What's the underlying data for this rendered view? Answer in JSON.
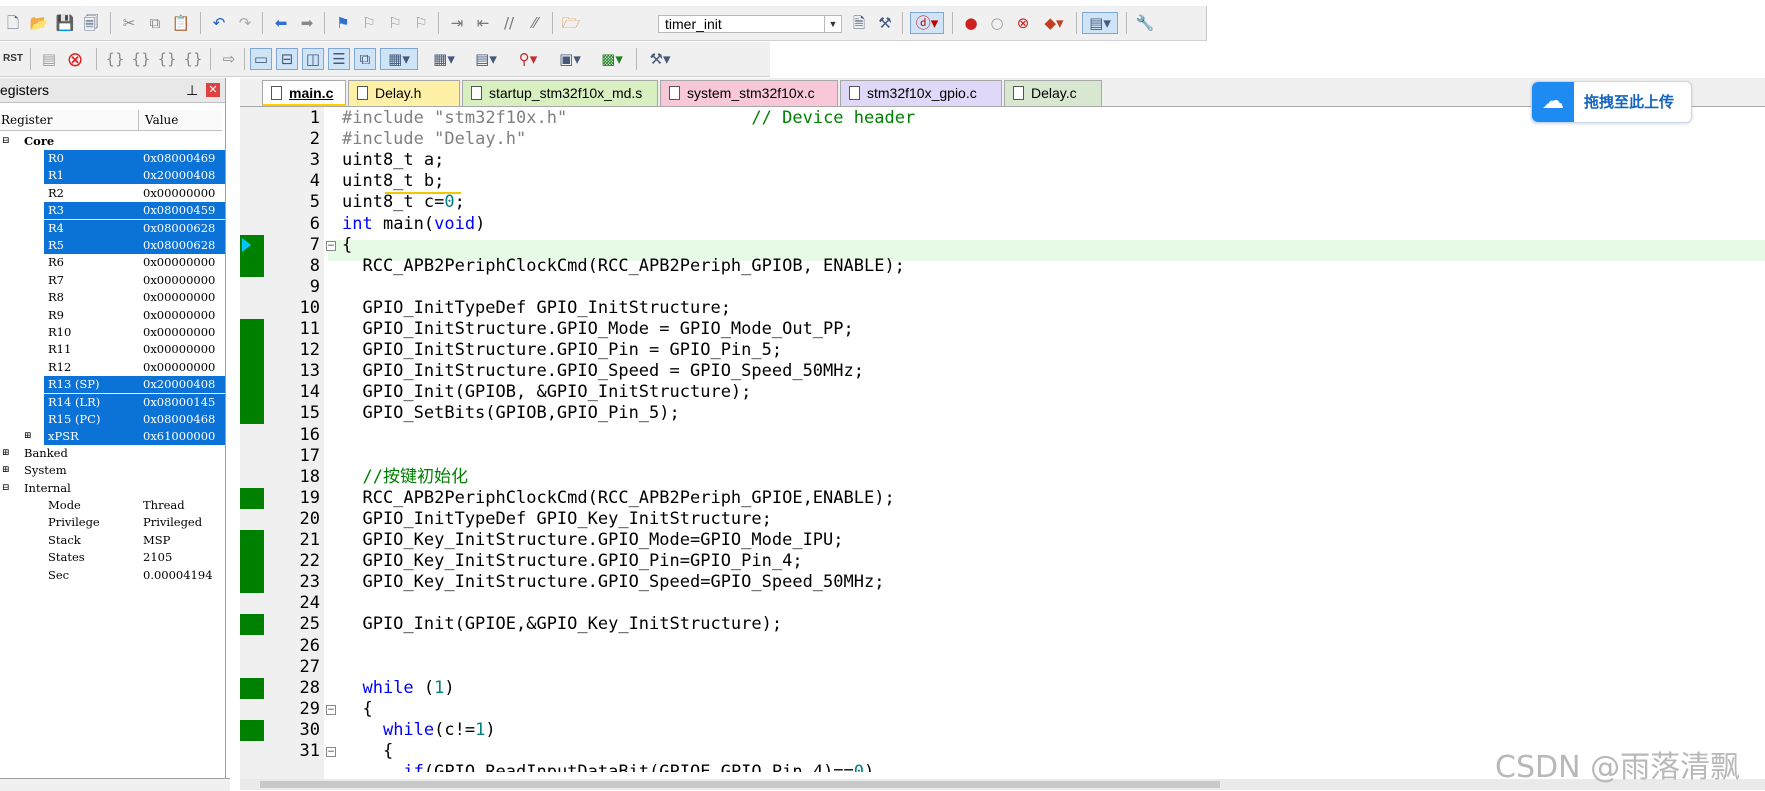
{
  "toolbar": {
    "target_name": "timer_init",
    "rst_label": "RST"
  },
  "registers": {
    "title": "egisters",
    "col_register": "Register",
    "col_value": "Value",
    "core_label": "Core",
    "rows": [
      {
        "name": "R0",
        "value": "0x08000469",
        "selected": true
      },
      {
        "name": "R1",
        "value": "0x20000408",
        "selected": true
      },
      {
        "name": "R2",
        "value": "0x00000000",
        "selected": false
      },
      {
        "name": "R3",
        "value": "0x08000459",
        "selected": true
      },
      {
        "name": "R4",
        "value": "0x08000628",
        "selected": true
      },
      {
        "name": "R5",
        "value": "0x08000628",
        "selected": true
      },
      {
        "name": "R6",
        "value": "0x00000000",
        "selected": false
      },
      {
        "name": "R7",
        "value": "0x00000000",
        "selected": false
      },
      {
        "name": "R8",
        "value": "0x00000000",
        "selected": false
      },
      {
        "name": "R9",
        "value": "0x00000000",
        "selected": false
      },
      {
        "name": "R10",
        "value": "0x00000000",
        "selected": false
      },
      {
        "name": "R11",
        "value": "0x00000000",
        "selected": false
      },
      {
        "name": "R12",
        "value": "0x00000000",
        "selected": false
      },
      {
        "name": "R13 (SP)",
        "value": "0x20000408",
        "selected": true
      },
      {
        "name": "R14 (LR)",
        "value": "0x08000145",
        "selected": true
      },
      {
        "name": "R15 (PC)",
        "value": "0x08000468",
        "selected": true
      },
      {
        "name": "xPSR",
        "value": "0x61000000",
        "selected": true
      }
    ],
    "groups": [
      "Banked",
      "System",
      "Internal"
    ],
    "internal": [
      {
        "name": "Mode",
        "value": "Thread"
      },
      {
        "name": "Privilege",
        "value": "Privileged"
      },
      {
        "name": "Stack",
        "value": "MSP"
      },
      {
        "name": "States",
        "value": "2105"
      },
      {
        "name": "Sec",
        "value": "0.00004194"
      }
    ]
  },
  "tabs": [
    {
      "label": "main.c",
      "color": "#fff3b0",
      "active": true
    },
    {
      "label": "Delay.h",
      "color": "#fff0a8",
      "active": false
    },
    {
      "label": "startup_stm32f10x_md.s",
      "color": "#d8f0c0",
      "active": false
    },
    {
      "label": "system_stm32f10x.c",
      "color": "#f8c8d8",
      "active": false
    },
    {
      "label": "stm32f10x_gpio.c",
      "color": "#e0d8f8",
      "active": false
    },
    {
      "label": "Delay.c",
      "color": "#d8e8d0",
      "active": false
    }
  ],
  "code": {
    "line_numbers": [
      "1",
      "2",
      "3",
      "4",
      "5",
      "6",
      "7",
      "8",
      "9",
      "10",
      "11",
      "12",
      "13",
      "14",
      "15",
      "16",
      "17",
      "18",
      "19",
      "20",
      "21",
      "22",
      "23",
      "24",
      "25",
      "26",
      "27",
      "28",
      "29",
      "30",
      "31"
    ],
    "lines": [
      "#include \"stm32f10x.h\"                  // Device header",
      "#include \"Delay.h\"",
      "uint8_t a;",
      "uint8_t b;",
      "uint8_t c=0;",
      "int main(void)",
      "{",
      "  RCC_APB2PeriphClockCmd(RCC_APB2Periph_GPIOB, ENABLE);",
      "",
      "  GPIO_InitTypeDef GPIO_InitStructure;",
      "  GPIO_InitStructure.GPIO_Mode = GPIO_Mode_Out_PP;",
      "  GPIO_InitStructure.GPIO_Pin = GPIO_Pin_5;",
      "  GPIO_InitStructure.GPIO_Speed = GPIO_Speed_50MHz;",
      "  GPIO_Init(GPIOB, &GPIO_InitStructure);",
      "  GPIO_SetBits(GPIOB,GPIO_Pin_5);",
      "",
      "",
      "  //按键初始化",
      "  RCC_APB2PeriphClockCmd(RCC_APB2Periph_GPIOE,ENABLE);",
      "  GPIO_InitTypeDef GPIO_Key_InitStructure;",
      "  GPIO_Key_InitStructure.GPIO_Mode=GPIO_Mode_IPU;",
      "  GPIO_Key_InitStructure.GPIO_Pin=GPIO_Pin_4;",
      "  GPIO_Key_InitStructure.GPIO_Speed=GPIO_Speed_50MHz;",
      "",
      "  GPIO_Init(GPIOE,&GPIO_Key_InitStructure);",
      "",
      "",
      "  while (1)",
      "  {",
      "    while(c!=1)",
      "    {"
    ],
    "partial_line": "      if(GPIO_ReadInputDataBit(GPIOE,GPIO_Pin_4)==0)"
  },
  "upload": {
    "label": "拖拽至此上传"
  },
  "watermark": "CSDN @雨落清飘"
}
